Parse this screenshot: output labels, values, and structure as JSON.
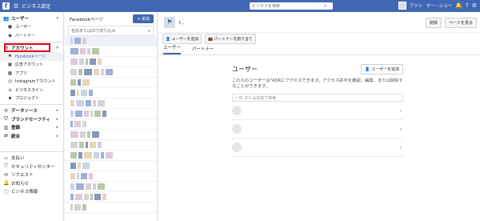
{
  "topbar": {
    "logo": "f",
    "menu_icon": "☰",
    "title": "ビジネス設定",
    "search_placeholder": "ビジネスを検索",
    "user_name": "アツシ",
    "user_extra": "マー・ショー",
    "icons": [
      "bell-icon",
      "question-icon",
      "gear-icon"
    ]
  },
  "sidebar": {
    "users_header": "ユーザー",
    "users_items": [
      "ユーザー",
      "パートナー"
    ],
    "accounts_header": "アカウント",
    "accounts_items": [
      "Facebookページ",
      "広告アカウント",
      "アプリ",
      "Instagramアカウント",
      "ビジネスライン",
      "プロジェクト"
    ],
    "sections": [
      "データソース",
      "ブランドセーフティ",
      "登録",
      "統合"
    ],
    "bottom_items": [
      "支払い",
      "セキュリティセンター",
      "リクエスト",
      "お知らせ",
      "ビジネス情報"
    ]
  },
  "pages_list": {
    "title": "Facebookページ",
    "add_label": "+ 追加",
    "filter_placeholder": "名前またはIDで絞り込み",
    "rows": 17
  },
  "main": {
    "page_name_suffix": "t",
    "page_name": "、",
    "delete_label": "削除",
    "view_page_label": "ページを見る",
    "add_user_label": "ユーザーを追加",
    "assign_partner_label": "パートナーを割り当て",
    "tabs": [
      "ユーザー",
      "パートナー"
    ],
    "panel_title": "ユーザー",
    "panel_add_label": "ユーザーを追加",
    "panel_desc": "これらのユーザーは\"ADKにアクセスできます。アクセス許可を確認、編集、または削除することができます。",
    "panel_search_placeholder": "ID または名前で検索",
    "users": [
      {
        "name": ""
      },
      {
        "name": ""
      },
      {
        "name": ""
      }
    ]
  },
  "colors": {
    "brand": "#4267b2",
    "highlight": "#e0001a"
  }
}
